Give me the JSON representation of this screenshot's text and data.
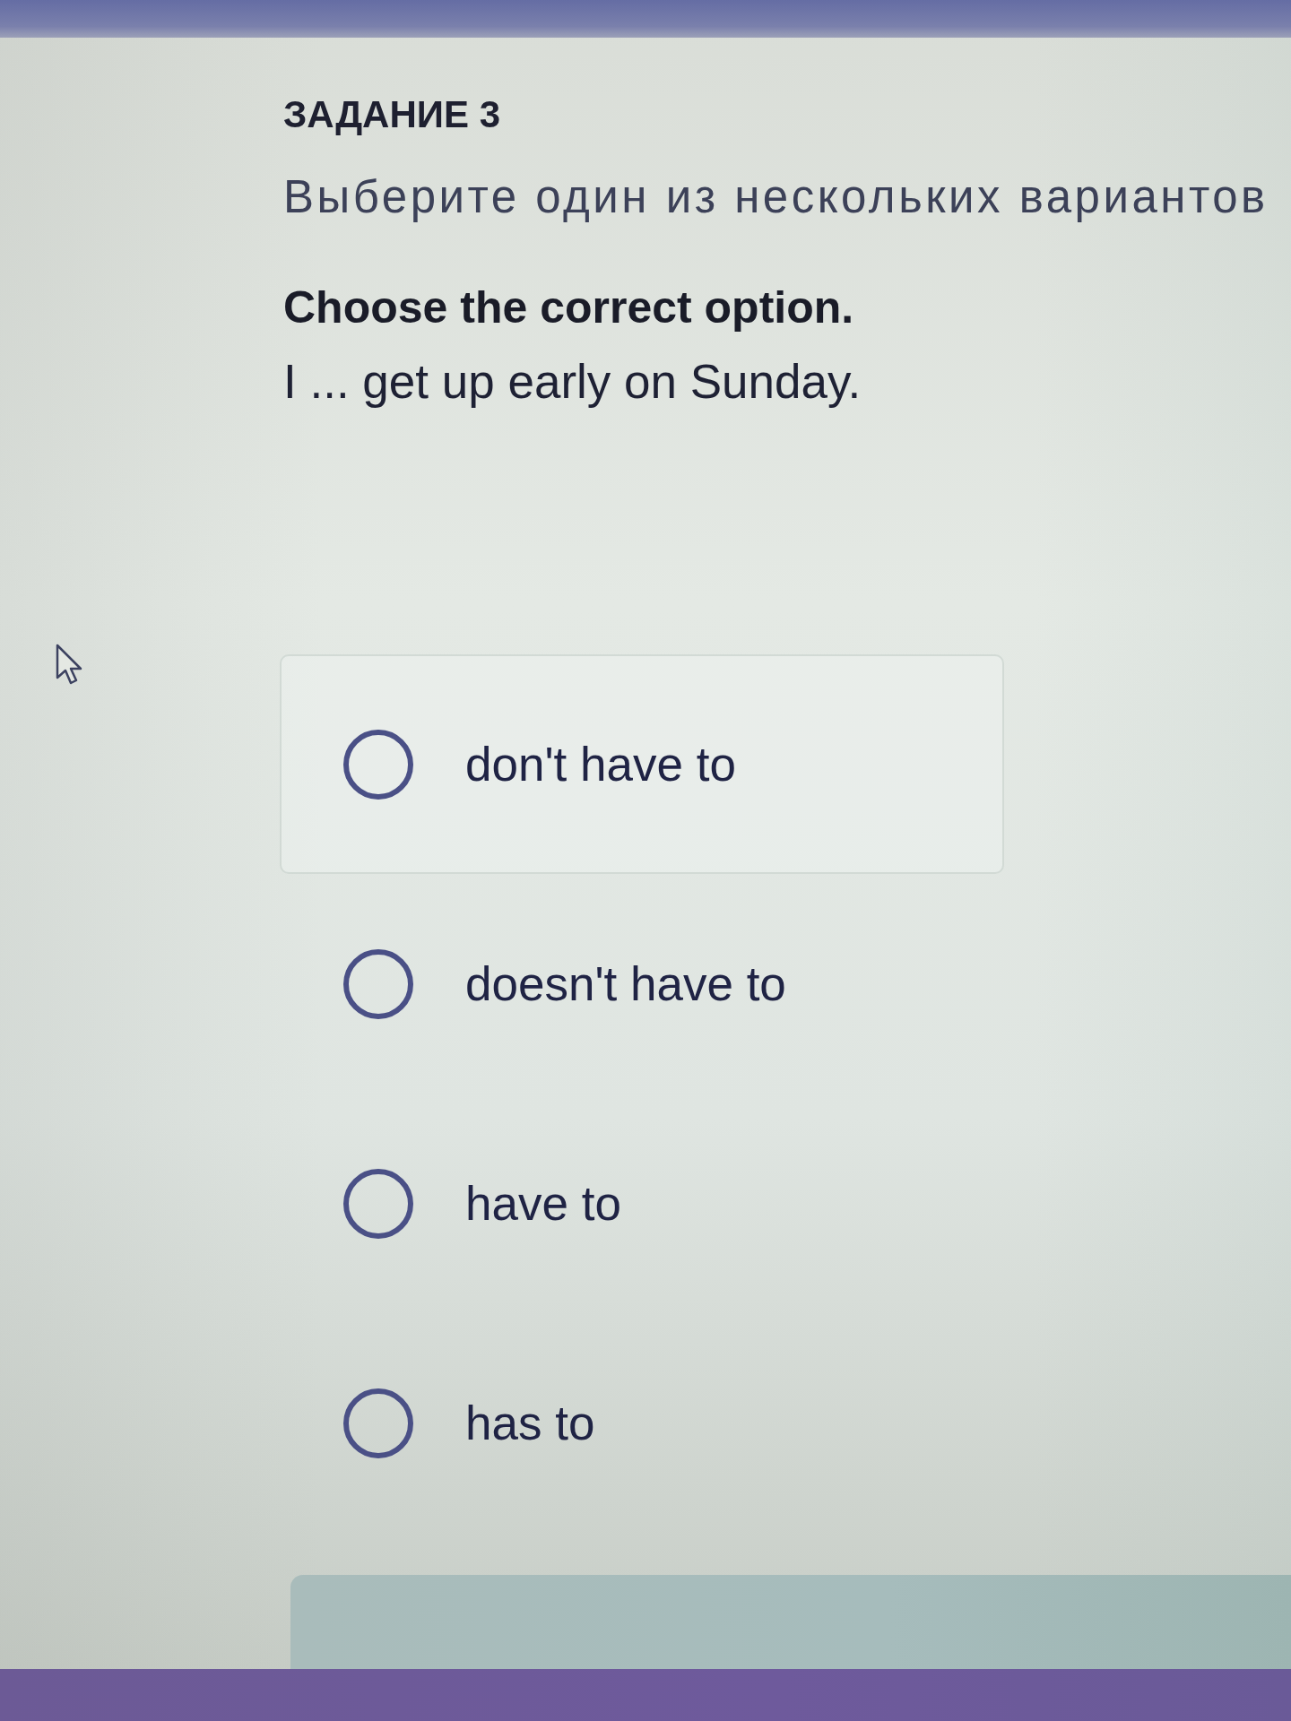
{
  "task": {
    "number_label": "ЗАДАНИЕ 3",
    "instruction": "Выберите один из нескольких вариантов"
  },
  "question": {
    "prompt": "Choose the correct option.",
    "sentence": "I ... get up early on Sunday."
  },
  "options": [
    {
      "label": "don't have to",
      "selected": false,
      "highlighted": true
    },
    {
      "label": "doesn't have to",
      "selected": false,
      "highlighted": false
    },
    {
      "label": "have to",
      "selected": false,
      "highlighted": false
    },
    {
      "label": "has to",
      "selected": false,
      "highlighted": false
    }
  ]
}
